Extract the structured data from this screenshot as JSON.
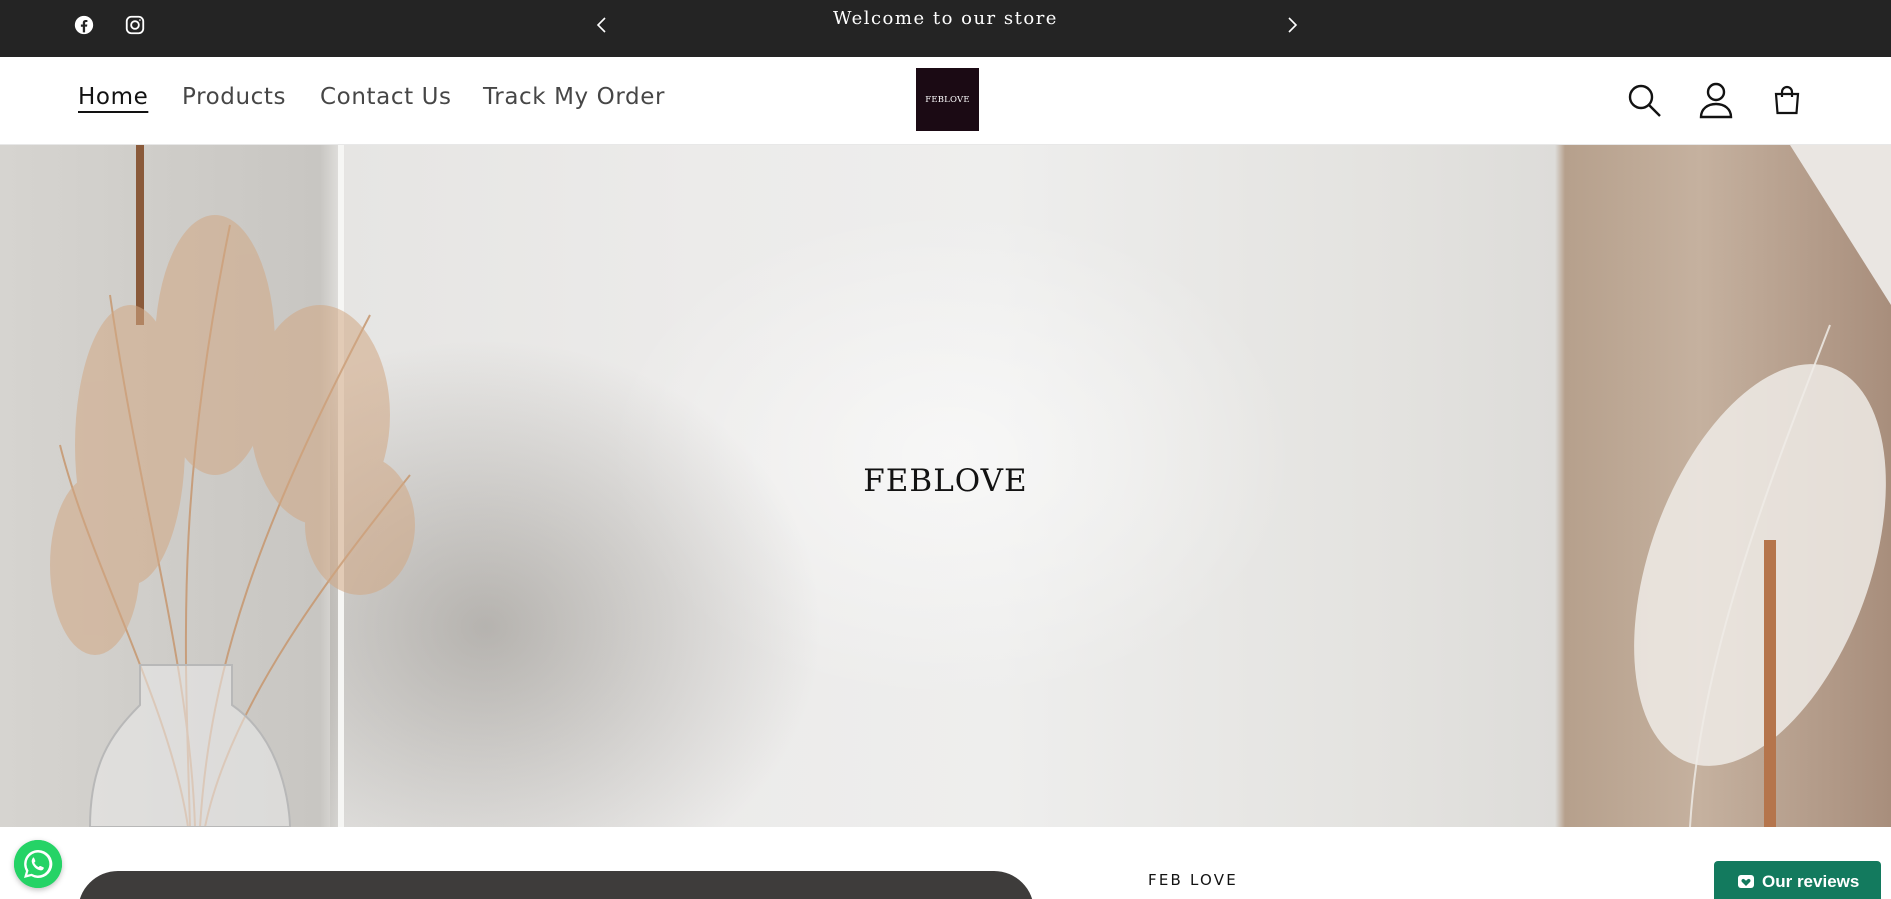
{
  "announcement": {
    "text": "Welcome to our store",
    "prev_icon": "chevron-left-icon",
    "next_icon": "chevron-right-icon",
    "social": [
      "facebook-icon",
      "instagram-icon"
    ]
  },
  "header": {
    "nav": [
      {
        "label": "Home",
        "active": true
      },
      {
        "label": "Products",
        "active": false
      },
      {
        "label": "Contact Us",
        "active": false
      },
      {
        "label": "Track My Order",
        "active": false
      }
    ],
    "logo_text": "FEBLOVE",
    "icons": [
      "search-icon",
      "account-icon",
      "cart-icon"
    ]
  },
  "hero": {
    "title": "FEBLOVE"
  },
  "section": {
    "brand_label": "FEB LOVE"
  },
  "widgets": {
    "whatsapp_icon": "whatsapp-icon",
    "reviews_label": "Our reviews"
  },
  "colors": {
    "announcement_bg": "#242424",
    "logo_bg": "#1b0a14",
    "reviews_bg": "#137a5e",
    "whatsapp": "#25d366"
  }
}
